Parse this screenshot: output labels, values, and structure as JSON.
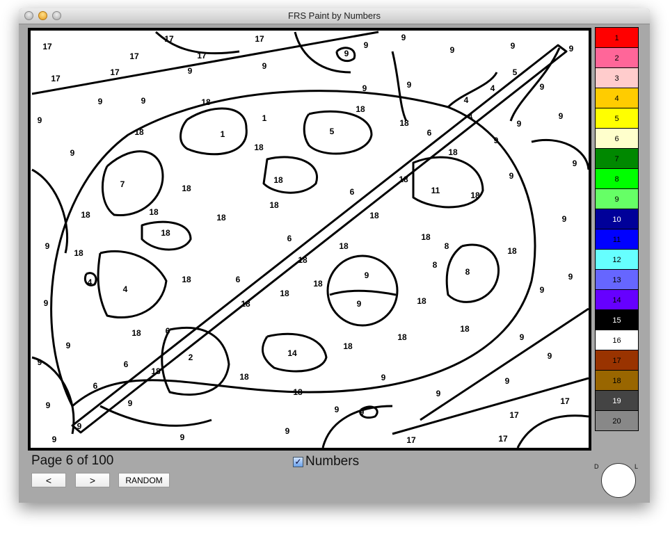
{
  "window": {
    "title": "FRS Paint by Numbers"
  },
  "canvas": {
    "labels": [
      "17",
      "17",
      "17",
      "17",
      "17",
      "17",
      "17",
      "9",
      "9",
      "9",
      "9",
      "9",
      "9",
      "5",
      "4",
      "9",
      "9",
      "9",
      "9",
      "9",
      "4",
      "4",
      "9",
      "9",
      "18",
      "18",
      "1",
      "1",
      "18",
      "6",
      "9",
      "18",
      "5",
      "9",
      "9",
      "18",
      "18",
      "9",
      "9",
      "9",
      "18",
      "6",
      "11",
      "18",
      "7",
      "18",
      "18",
      "18",
      "18",
      "9",
      "18",
      "18",
      "18",
      "18",
      "9",
      "6",
      "18",
      "8",
      "9",
      "18",
      "18",
      "18",
      "8",
      "8",
      "18",
      "4",
      "4",
      "18",
      "6",
      "18",
      "9",
      "18",
      "9",
      "9",
      "9",
      "18",
      "18",
      "9",
      "18",
      "6",
      "18",
      "18",
      "18",
      "9",
      "9",
      "2",
      "14",
      "6",
      "9",
      "18",
      "9",
      "18",
      "9",
      "6",
      "9",
      "18",
      "9",
      "9",
      "9",
      "9",
      "9",
      "17",
      "17",
      "9",
      "9",
      "9",
      "9",
      "17",
      "17"
    ]
  },
  "palette": [
    {
      "label": "1",
      "color": "#ff0000",
      "text": "#000"
    },
    {
      "label": "2",
      "color": "#ff6699",
      "text": "#000"
    },
    {
      "label": "3",
      "color": "#ffcccc",
      "text": "#000"
    },
    {
      "label": "4",
      "color": "#ffcc00",
      "text": "#000"
    },
    {
      "label": "5",
      "color": "#ffff00",
      "text": "#000"
    },
    {
      "label": "6",
      "color": "#ffffcc",
      "text": "#000"
    },
    {
      "label": "7",
      "color": "#008800",
      "text": "#000"
    },
    {
      "label": "8",
      "color": "#00ff00",
      "text": "#000"
    },
    {
      "label": "9",
      "color": "#66ff66",
      "text": "#000"
    },
    {
      "label": "10",
      "color": "#000099",
      "text": "#fff"
    },
    {
      "label": "11",
      "color": "#0000ff",
      "text": "#000"
    },
    {
      "label": "12",
      "color": "#66ffff",
      "text": "#000"
    },
    {
      "label": "13",
      "color": "#6666ff",
      "text": "#000"
    },
    {
      "label": "14",
      "color": "#6600ff",
      "text": "#000"
    },
    {
      "label": "15",
      "color": "#000000",
      "text": "#fff"
    },
    {
      "label": "16",
      "color": "#ffffff",
      "text": "#000"
    },
    {
      "label": "17",
      "color": "#993300",
      "text": "#000"
    },
    {
      "label": "18",
      "color": "#996600",
      "text": "#000"
    },
    {
      "label": "19",
      "color": "#444444",
      "text": "#fff"
    },
    {
      "label": "20",
      "color": "#888888",
      "text": "#000"
    }
  ],
  "footer": {
    "page_label": "Page 6 of 100",
    "numbers_label": "Numbers",
    "numbers_checked": true,
    "checkmark": "✓",
    "prev_label": "<",
    "next_label": ">",
    "random_label": "RANDOM"
  },
  "color_picker": {
    "dark_label": "D",
    "light_label": "L",
    "current_color": "#ffffff"
  }
}
